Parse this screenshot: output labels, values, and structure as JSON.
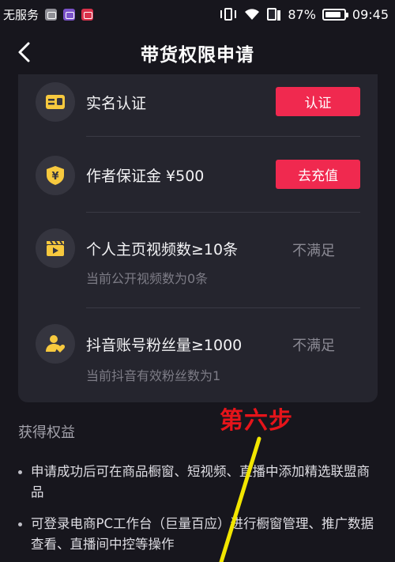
{
  "status_bar": {
    "carrier": "无服务",
    "app_icons": [
      "gallery-icon",
      "keyboard-icon",
      "weibo-icon"
    ],
    "battery_percent": "87%",
    "battery_level": 0.87,
    "time": "09:45"
  },
  "nav": {
    "title": "带货权限申请"
  },
  "requirements": [
    {
      "icon": "id-card-icon",
      "title": "实名认证",
      "action": "认证"
    },
    {
      "icon": "shield-yuan-icon",
      "title": "作者保证金 ¥500",
      "action": "去充值"
    },
    {
      "icon": "video-clapper-icon",
      "title": "个人主页视频数≥10条",
      "status": "不满足",
      "detail": "当前公开视频数为0条"
    },
    {
      "icon": "fans-heart-icon",
      "title": "抖音账号粉丝量≥1000",
      "status": "不满足",
      "detail": "当前抖音有效粉丝数为1"
    }
  ],
  "benefits": {
    "title": "获得权益",
    "items": [
      "申请成功后可在商品橱窗、短视频、直播中添加精选联盟商品",
      "可登录电商PC工作台（巨量百应）进行橱窗管理、推广数据查看、直播间中控等操作"
    ]
  },
  "annotation": {
    "label": "第六步"
  },
  "colors": {
    "background": "#17161d",
    "card": "#25252e",
    "accent": "#f0294f",
    "icon_yellow": "#f7c93e",
    "annotation_red": "#e6141a",
    "annotation_arrow": "#f2e600"
  }
}
